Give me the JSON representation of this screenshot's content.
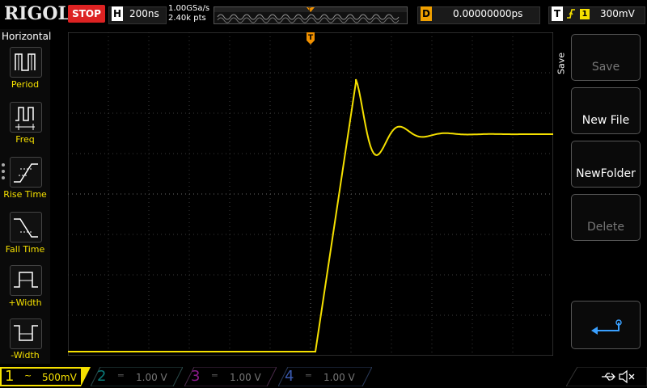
{
  "topbar": {
    "brand": "RIGOL",
    "run_state": "STOP",
    "horizontal_letter": "H",
    "timebase": "200ns",
    "sample_rate": "1.00GSa/s",
    "memory_depth": "2.40k pts",
    "trigger_marker": "T",
    "delay_letter": "D",
    "delay_value": "0.00000000ps",
    "trigger_letter": "T",
    "trigger_edge_icon": "rising-edge-icon",
    "trigger_channel": "1",
    "trigger_level": "300mV"
  },
  "left_menu": {
    "title": "Horizontal",
    "items": [
      {
        "label": "Period",
        "icon": "period-icon"
      },
      {
        "label": "Freq",
        "icon": "frequency-icon"
      },
      {
        "label": "Rise Time",
        "icon": "rise-time-icon"
      },
      {
        "label": "Fall Time",
        "icon": "fall-time-icon"
      },
      {
        "label": "+Width",
        "icon": "positive-width-icon"
      },
      {
        "label": "-Width",
        "icon": "negative-width-icon"
      }
    ]
  },
  "right_menu": {
    "tab": "Save",
    "buttons": [
      {
        "label": "Save",
        "enabled": false
      },
      {
        "label": "New File",
        "enabled": true
      },
      {
        "label": "NewFolder",
        "enabled": true
      },
      {
        "label": "Delete",
        "enabled": false
      }
    ],
    "return_icon": "return-arrow-icon"
  },
  "channels": [
    {
      "num": "1",
      "coupling_icon": "ac-coupling-icon",
      "scale": "500mV",
      "color": "#f5e000",
      "active": true
    },
    {
      "num": "2",
      "coupling_icon": "dc-coupling-icon",
      "scale": "1.00 V",
      "color": "#00c8c8",
      "active": false
    },
    {
      "num": "3",
      "coupling_icon": "dc-coupling-icon",
      "scale": "1.00 V",
      "color": "#d020d0",
      "active": false
    },
    {
      "num": "4",
      "coupling_icon": "dc-coupling-icon",
      "scale": "1.00 V",
      "color": "#3a6ad8",
      "active": false
    }
  ],
  "status_icons": [
    "usb-icon",
    "speaker-muted-icon"
  ],
  "colors": {
    "ch1": "#f5e000",
    "stop": "#dd2222",
    "trigger": "#f09000",
    "grid": "#4a4a4a"
  },
  "waveform": {
    "channel": "1",
    "shape": "step-response-with-ringing"
  }
}
